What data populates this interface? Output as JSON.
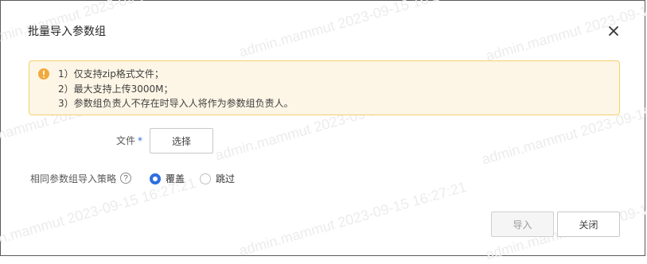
{
  "dialog": {
    "title": "批量导入参数组",
    "close_icon": "close-icon"
  },
  "notice": {
    "icon": "warning-icon",
    "icon_color": "#f2a93b",
    "lines": [
      "1）仅支持zip格式文件；",
      "2）最大支持上传3000M；",
      "3）参数组负责人不存在时导入人将作为参数组负责人。"
    ]
  },
  "form": {
    "file_label": "文件",
    "required_mark": "*",
    "select_button": "选择",
    "strategy_label": "相同参数组导入策略",
    "help_icon": "?",
    "options": [
      {
        "label": "覆盖",
        "checked": true
      },
      {
        "label": "跳过",
        "checked": false
      }
    ]
  },
  "footer": {
    "import_button": "导入",
    "close_button": "关闭"
  },
  "watermark": {
    "text": "admin.mammut 2023-09-15 16:27:21"
  },
  "colors": {
    "accent": "#2f6fe0",
    "notice_bg": "#fdf6e6",
    "notice_border": "#f5cf6e"
  }
}
